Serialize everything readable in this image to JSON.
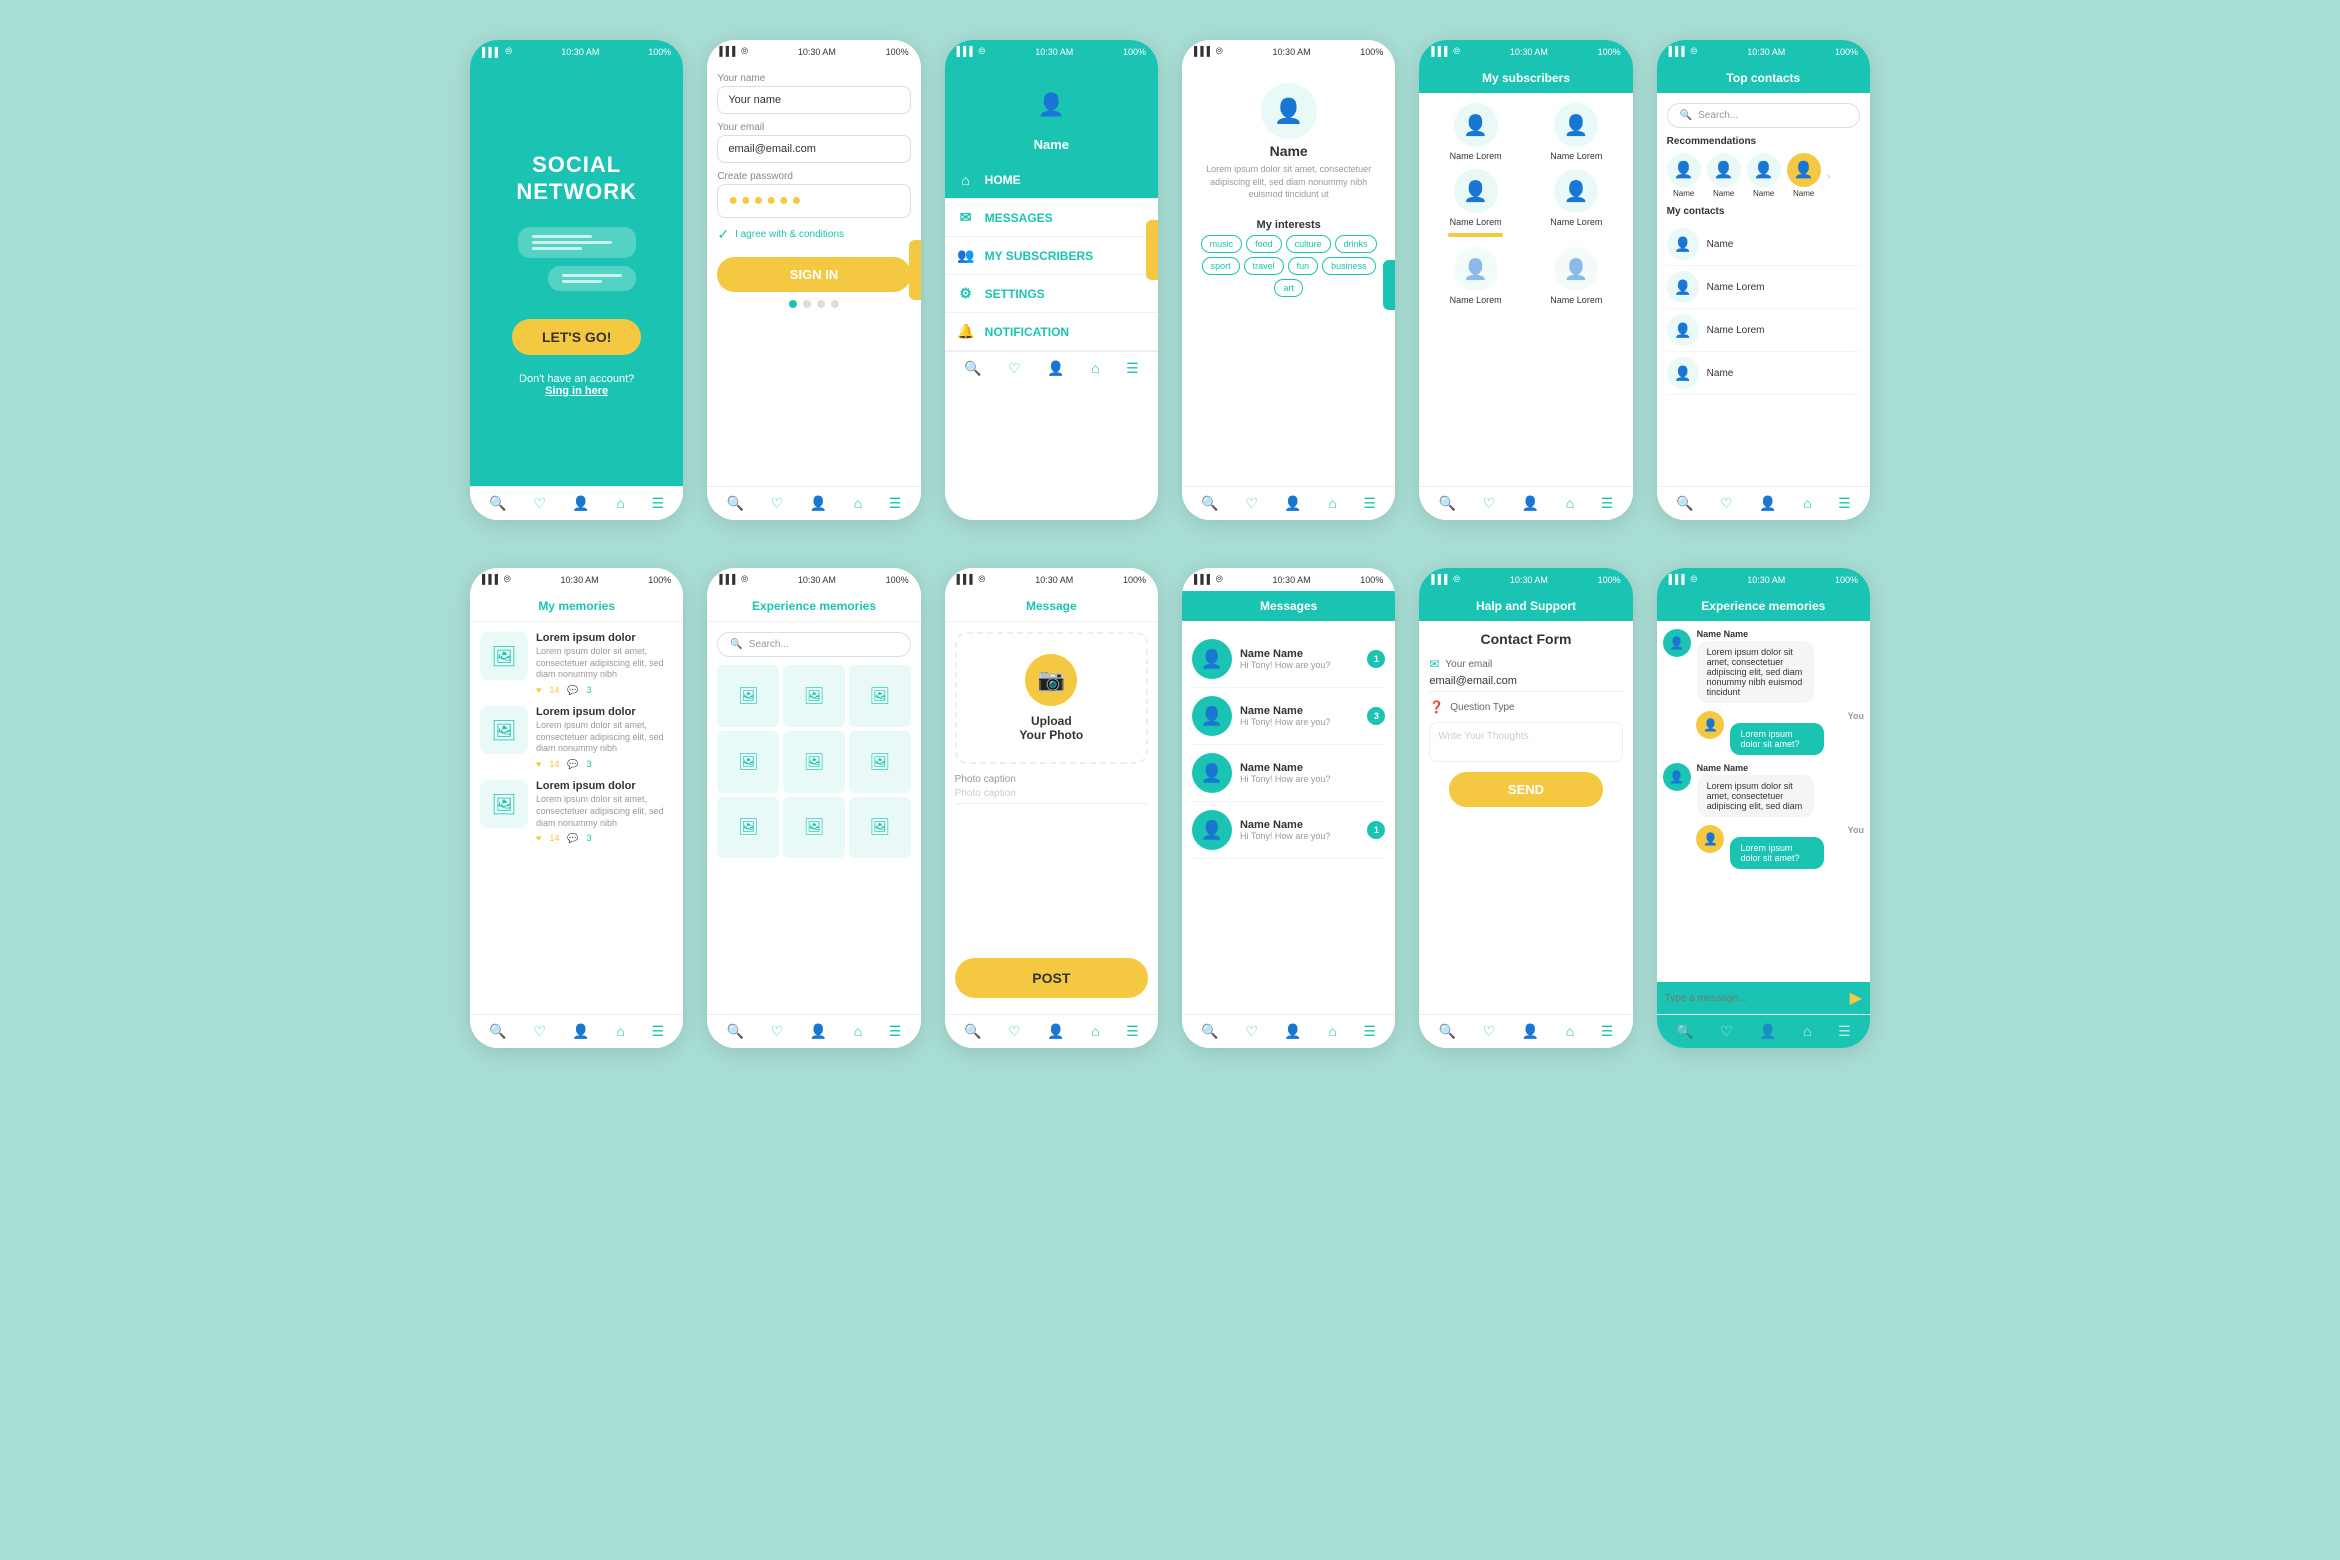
{
  "app": {
    "background": "#a8ddd4",
    "status_time": "10:30 AM",
    "status_battery": "100%"
  },
  "phone1": {
    "title": "SOCIAL NETWORK",
    "btn_label": "LET'S GO!",
    "no_account": "Don't have an account?",
    "signin_link": "Sing in here"
  },
  "phone2": {
    "name_label": "Your name",
    "name_placeholder": "Your name",
    "email_label": "Your email",
    "email_value": "email@email.com",
    "password_label": "Create password",
    "agree_text": "I agree with & conditions",
    "btn_label": "SIGN IN"
  },
  "phone3": {
    "avatar_name": "Name",
    "menu_items": [
      {
        "label": "HOME",
        "icon": "⌂",
        "active": true
      },
      {
        "label": "MESSAGES",
        "icon": "✉"
      },
      {
        "label": "MY SUBSCRIBERS",
        "icon": "👥"
      },
      {
        "label": "SETTINGS",
        "icon": "⚙"
      },
      {
        "label": "NOTIFICATION",
        "icon": "🔔"
      }
    ]
  },
  "phone4": {
    "name": "Name",
    "bio": "Lorem ipsum dolor sit amet, consectetuer adipiscing elit, sed diam nonummy nibh euismod tincidunt ut",
    "interests_title": "My interests",
    "tags": [
      "music",
      "food",
      "culture",
      "drinks",
      "sport",
      "travel",
      "fun",
      "business",
      "art"
    ]
  },
  "phone5": {
    "header": "My subscribers",
    "subscribers": [
      {
        "name": "Name Lorem"
      },
      {
        "name": "Name Lorem"
      },
      {
        "name": "Name Lorem"
      },
      {
        "name": "Name Lorem"
      },
      {
        "name": "Name Lorem"
      },
      {
        "name": "Name Lorem"
      }
    ]
  },
  "phone6": {
    "header": "Top contacts",
    "search_placeholder": "Search...",
    "recommendations_title": "Recommendations",
    "recommendations": [
      {
        "name": "Name"
      },
      {
        "name": "Name"
      },
      {
        "name": "Name"
      },
      {
        "name": "Name"
      }
    ],
    "contacts_title": "My contacts",
    "contacts": [
      {
        "name": "Name"
      },
      {
        "name": "Name Lorem"
      },
      {
        "name": "Name Lorem"
      },
      {
        "name": "Name"
      }
    ]
  },
  "phone7": {
    "header": "My memories",
    "items": [
      {
        "title": "Lorem ipsum dolor",
        "text": "Lorem ipsum dolor sit amet, consectetuer adipiscing elit, sed diam nonummy nibh",
        "likes": "14",
        "comments": "3"
      },
      {
        "title": "Lorem ipsum dolor",
        "text": "Lorem ipsum dolor sit amet, consectetuer adipiscing elit, sed diam nonummy nibh",
        "likes": "14",
        "comments": "3"
      },
      {
        "title": "Lorem ipsum dolor",
        "text": "Lorem ipsum dolor sit amet, consectetuer adipiscing elit, sed diam nonummy nibh",
        "likes": "14",
        "comments": "3"
      }
    ]
  },
  "phone8": {
    "header": "Experience memories",
    "search_placeholder": "Search..."
  },
  "phone9": {
    "header": "Message",
    "upload_label": "Upload\nYour Photo",
    "caption_label": "Photo caption",
    "caption_placeholder": "Photo caption",
    "btn_label": "POST"
  },
  "phone10": {
    "header": "Messages",
    "messages": [
      {
        "name": "Name Name",
        "preview": "Hi Tony! How are you?",
        "badge": "1"
      },
      {
        "name": "Name Name",
        "preview": "Hi Tony! How are you?",
        "badge": "3"
      },
      {
        "name": "Name Name",
        "preview": "Hi Tony! How are you?",
        "badge": ""
      },
      {
        "name": "Name Name",
        "preview": "Hi Tony! How are you?",
        "badge": "1"
      }
    ]
  },
  "phone11": {
    "header": "Halp and Support",
    "form_title": "Contact Form",
    "email_label": "Your email",
    "email_value": "email@email.com",
    "question_label": "Question Type",
    "thoughts_placeholder": "Write Your Thoughts",
    "btn_label": "SEND"
  },
  "phone12": {
    "header": "Experience memories",
    "messages": [
      {
        "sender": "Name Name",
        "text": "Lorem ipsum dolor sit amet, consectetuer adipiscing elit, sed diam nonummy nibh euismod tincidunt",
        "type": "received"
      },
      {
        "sender": "You",
        "text": "Lorem ipsum dolor sit amet?",
        "type": "sent"
      },
      {
        "sender": "Name Name",
        "text": "Lorem ipsum dolor sit amet, consectetuer adipiscing elit, sed diam",
        "type": "received"
      },
      {
        "sender": "You",
        "text": "Lorem ipsum dolor sit amet?",
        "type": "sent"
      }
    ],
    "input_placeholder": "Type a message...",
    "send_icon": "▶"
  }
}
